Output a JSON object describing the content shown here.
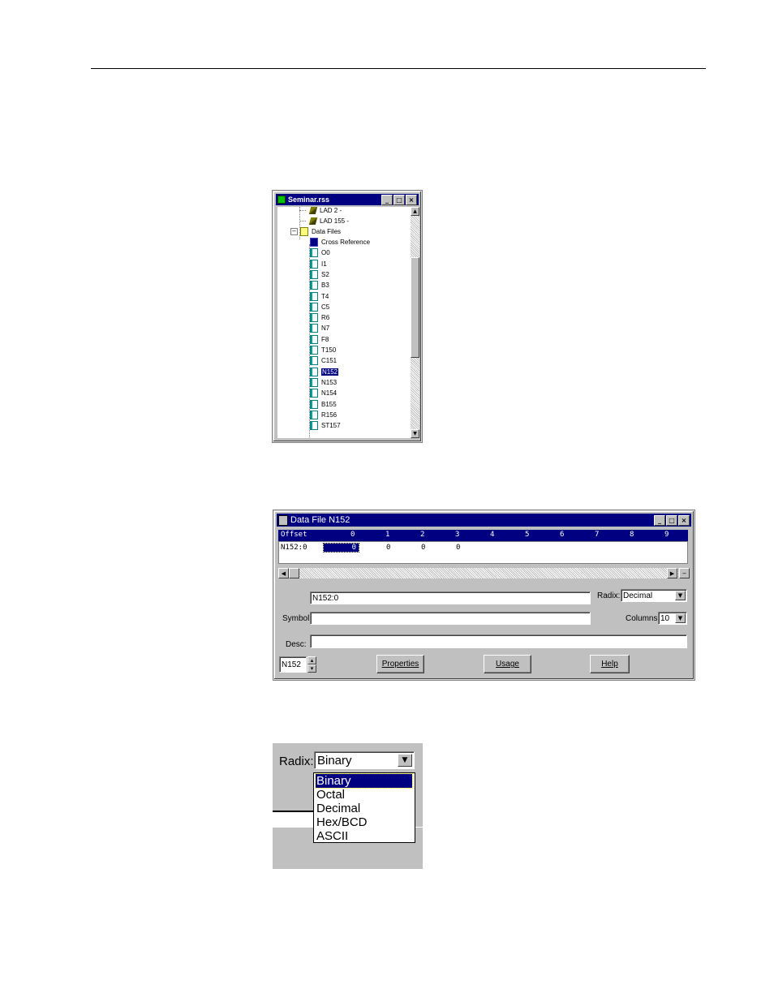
{
  "tree_window": {
    "title": "Seminar.rss",
    "items": [
      {
        "label": "LAD 2 -",
        "icon": "ladder-icon"
      },
      {
        "label": "LAD 155 -",
        "icon": "ladder-icon"
      },
      {
        "label": "Data Files",
        "icon": "folder-icon"
      },
      {
        "label": "Cross Reference",
        "icon": "cross-reference-icon"
      },
      {
        "label": "O0",
        "icon": "data-file-icon"
      },
      {
        "label": "I1",
        "icon": "data-file-icon"
      },
      {
        "label": "S2",
        "icon": "data-file-icon"
      },
      {
        "label": "B3",
        "icon": "data-file-icon"
      },
      {
        "label": "T4",
        "icon": "data-file-icon"
      },
      {
        "label": "C5",
        "icon": "data-file-icon"
      },
      {
        "label": "R6",
        "icon": "data-file-icon"
      },
      {
        "label": "N7",
        "icon": "data-file-icon"
      },
      {
        "label": "F8",
        "icon": "data-file-icon"
      },
      {
        "label": "T150",
        "icon": "data-file-icon"
      },
      {
        "label": "C151",
        "icon": "data-file-icon"
      },
      {
        "label": "N152",
        "icon": "data-file-icon"
      },
      {
        "label": "N153",
        "icon": "data-file-icon"
      },
      {
        "label": "N154",
        "icon": "data-file-icon"
      },
      {
        "label": "B155",
        "icon": "data-file-icon"
      },
      {
        "label": "R156",
        "icon": "data-file-icon"
      },
      {
        "label": "ST157",
        "icon": "data-file-icon"
      }
    ],
    "selected": "N152"
  },
  "data_file_window": {
    "title": "Data File N152",
    "grid": {
      "offset_header": "Offset",
      "columns": [
        "0",
        "1",
        "2",
        "3",
        "4",
        "5",
        "6",
        "7",
        "8",
        "9"
      ],
      "row_label": "N152:0",
      "values": [
        "0",
        "0",
        "0",
        "0"
      ]
    },
    "address_value": "N152:0",
    "symbol_label": "Symbol",
    "symbol_value": "",
    "desc_label": "Desc:",
    "desc_value": "",
    "radix_label": "Radix:",
    "radix_value": "Decimal",
    "columns_label": "Columns:",
    "columns_value": "10",
    "file_spinner_value": "N152",
    "buttons": {
      "properties": "Properties",
      "usage": "Usage",
      "help": "Help"
    }
  },
  "radix_dropdown": {
    "label": "Radix:",
    "current": "Binary",
    "options": [
      "Binary",
      "Octal",
      "Decimal",
      "Hex/BCD",
      "ASCII"
    ],
    "highlighted": "Binary"
  }
}
